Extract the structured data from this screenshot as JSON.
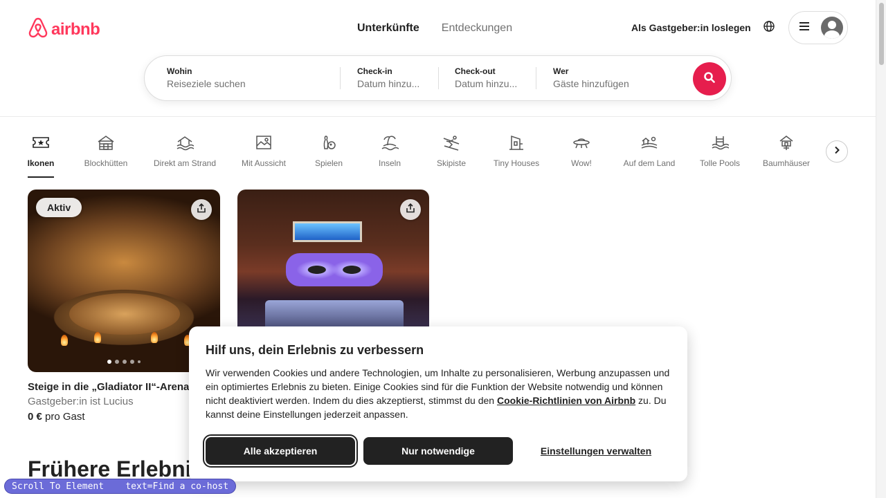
{
  "brand": {
    "name": "airbnb",
    "color": "#ff385c"
  },
  "nav": {
    "tabs": [
      {
        "label": "Unterkünfte",
        "active": true
      },
      {
        "label": "Entdeckungen",
        "active": false
      }
    ],
    "host_link": "Als Gastgeber:in loslegen",
    "globe_icon": "globe-icon",
    "menu_icon": "hamburger-icon"
  },
  "search": {
    "where": {
      "label": "Wohin",
      "placeholder": "Reiseziele suchen"
    },
    "checkin": {
      "label": "Check-in",
      "placeholder": "Datum hinzu..."
    },
    "checkout": {
      "label": "Check-out",
      "placeholder": "Datum hinzu..."
    },
    "who": {
      "label": "Wer",
      "placeholder": "Gäste hinzufügen"
    },
    "button_color": "#e61e4d"
  },
  "categories": [
    {
      "label": "Ikonen",
      "icon": "ticket-star-icon",
      "active": true
    },
    {
      "label": "Blockhütten",
      "icon": "cabin-icon"
    },
    {
      "label": "Direkt am Strand",
      "icon": "beach-icon"
    },
    {
      "label": "Mit Aussicht",
      "icon": "view-icon"
    },
    {
      "label": "Spielen",
      "icon": "bowling-icon"
    },
    {
      "label": "Inseln",
      "icon": "island-icon"
    },
    {
      "label": "Skipiste",
      "icon": "skier-icon"
    },
    {
      "label": "Tiny Houses",
      "icon": "tiny-house-icon"
    },
    {
      "label": "Wow!",
      "icon": "ufo-icon"
    },
    {
      "label": "Auf dem Land",
      "icon": "countryside-icon"
    },
    {
      "label": "Tolle Pools",
      "icon": "pool-icon"
    },
    {
      "label": "Baumhäuser",
      "icon": "treehouse-icon"
    }
  ],
  "listings": [
    {
      "badge": "Aktiv",
      "title": "Steige in die „Gladiator II“-Arena",
      "host": "Gastgeber:in ist Lucius",
      "price_amount": "0 €",
      "price_unit": "pro Gast",
      "image": "colosseum-arena",
      "dots": 5,
      "active_dot": 0
    },
    {
      "badge": "",
      "title": "",
      "host": "",
      "price_amount": "",
      "price_unit": "",
      "image": "purple-bedroom",
      "dots": 0,
      "active_dot": 0
    }
  ],
  "section": {
    "title": "Frühere Erlebnisse"
  },
  "cookie": {
    "title": "Hilf uns, dein Erlebnis zu verbessern",
    "text_before": "Wir verwenden Cookies und andere Technologien, um Inhalte zu personalisieren, Werbung anzupassen und ein optimiertes Erlebnis zu bieten. Einige Cookies sind für die Funktion der Website notwendig und können nicht deaktiviert werden. Indem du dies akzeptierst, stimmst du den ",
    "link": "Cookie-Richtlinien von Airbnb",
    "text_after": " zu. Du kannst deine Einstellungen jederzeit anpassen.",
    "accept_label": "Alle akzeptieren",
    "necessary_label": "Nur notwendige",
    "settings_label": "Einstellungen verwalten"
  },
  "overlay": {
    "label": "Scroll To Element    text=Find a co-host"
  }
}
